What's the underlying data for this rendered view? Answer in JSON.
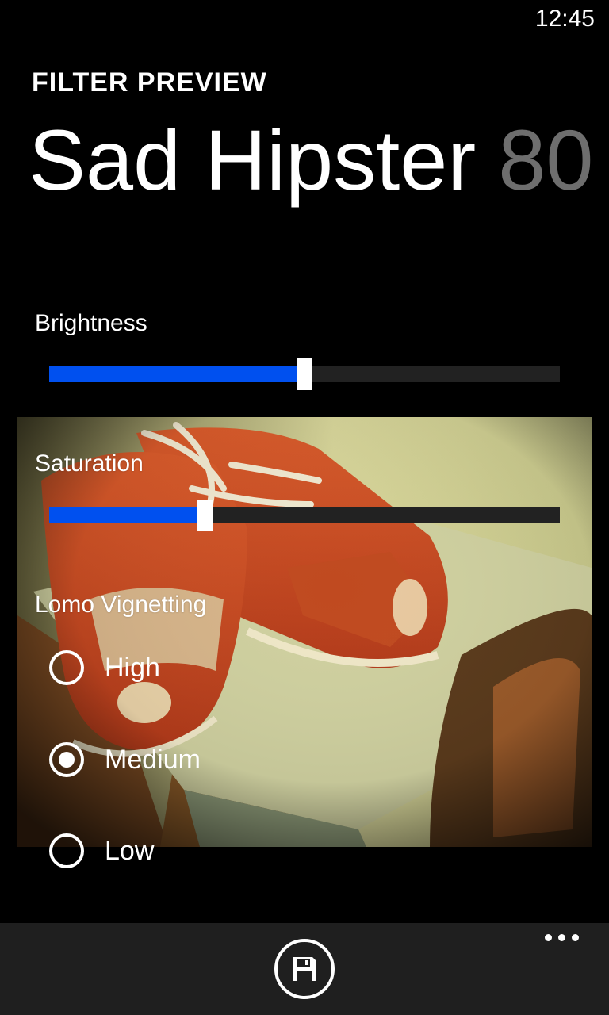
{
  "status_bar": {
    "time": "12:45"
  },
  "header": {
    "app_title": "FILTER PREVIEW",
    "pivot_current": "Sad Hipster",
    "pivot_next": "80"
  },
  "controls": {
    "brightness": {
      "label": "Brightness",
      "value": 0.5
    },
    "saturation": {
      "label": "Saturation",
      "value": 0.305
    },
    "vignetting": {
      "label": "Lomo Vignetting",
      "options": [
        {
          "label": "High",
          "checked": false
        },
        {
          "label": "Medium",
          "checked": true
        },
        {
          "label": "Low",
          "checked": false
        }
      ]
    }
  },
  "app_bar": {
    "save_icon": "save-icon",
    "more_icon": "ellipsis-icon"
  },
  "colors": {
    "accent": "#0050ef",
    "track": "#222222",
    "pivot_next": "#6e6e6e"
  }
}
